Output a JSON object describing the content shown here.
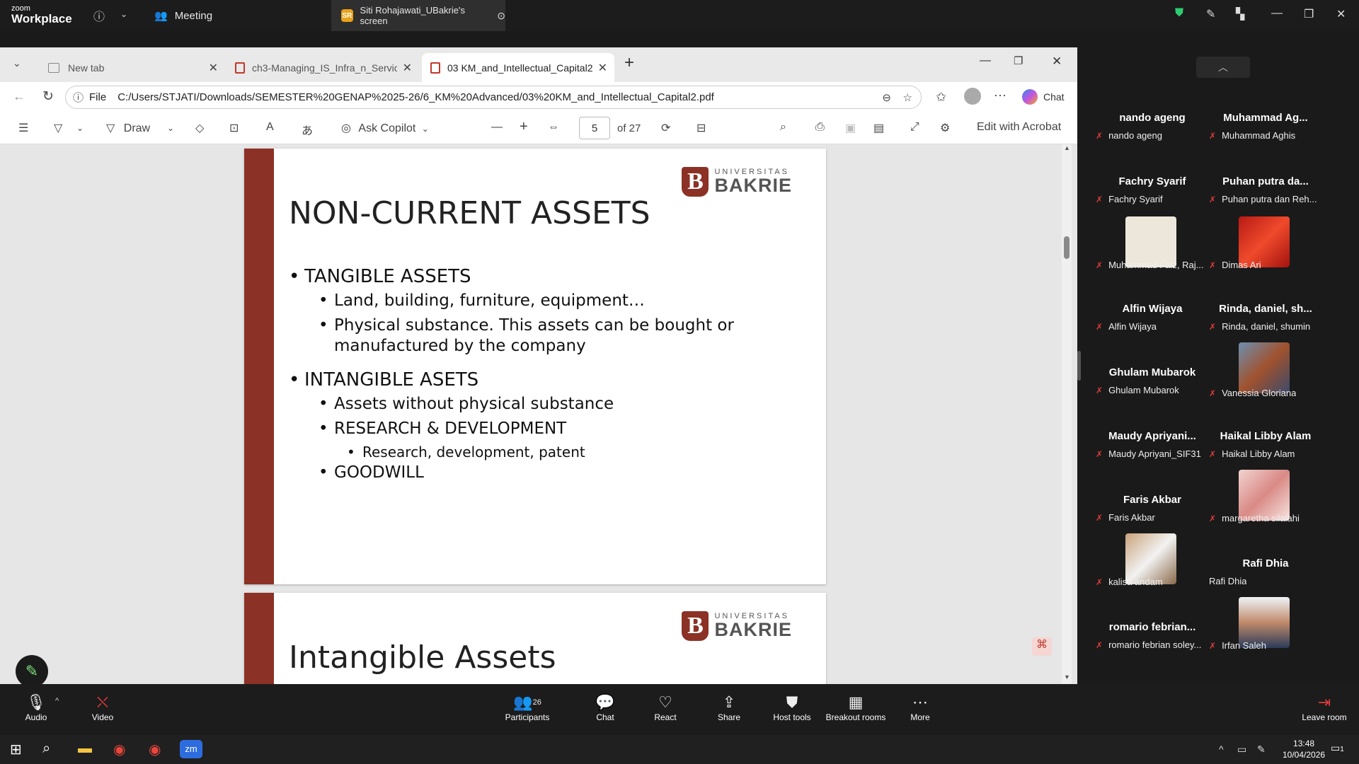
{
  "zoom": {
    "brand_top": "zoom",
    "brand": "Workplace",
    "meeting_tab": "Meeting",
    "share_badge": "SR",
    "share_tab": "Siti Rohajawati_UBakrie's screen"
  },
  "browser": {
    "tabs": [
      {
        "label": "New tab"
      },
      {
        "label": "ch3-Managing_IS_Infra_n_Services"
      },
      {
        "label": "03 KM_and_Intellectual_Capital2.pdf"
      }
    ],
    "url_prefix": "File",
    "url": "C:/Users/STJATI/Downloads/SEMESTER%20GENAP%2025-26/6_KM%20Advanced/03%20KM_and_Intellectual_Capital2.pdf",
    "chat_label": "Chat",
    "toolbar": {
      "draw": "Draw",
      "copilot": "Ask Copilot",
      "page": "5",
      "page_total": "of 27",
      "edit": "Edit with Acrobat"
    }
  },
  "slides": [
    {
      "logo_small": "UNIVERSITAS",
      "logo_big": "BAKRIE",
      "logo_letter": "B",
      "title": "NON-CURRENT ASSETS",
      "bullets": [
        "TANGIBLE ASSETS",
        "Land, building, furniture, equipment…",
        "Physical substance. This assets can be bought  or",
        "manufactured by the company",
        "INTANGIBLE ASETS",
        "Assets without physical substance",
        "RESEARCH & DEVELOPMENT",
        "Research, development, patent",
        "GOODWILL"
      ]
    },
    {
      "logo_small": "UNIVERSITAS",
      "logo_big": "BAKRIE",
      "logo_letter": "B",
      "title": "Intangible Assets"
    }
  ],
  "participants": [
    {
      "name": "nando ageng",
      "label": "nando ageng"
    },
    {
      "name": "Muhammad Ag...",
      "label": "Muhammad Aghis"
    },
    {
      "name": "Fachry Syarif",
      "label": "Fachry Syarif"
    },
    {
      "name": "Puhan putra da...",
      "label": "Puhan putra dan Reh..."
    },
    {
      "name": "",
      "label": "Muhammad Faiz, Raj..."
    },
    {
      "name": "",
      "label": "Dimas Ari"
    },
    {
      "name": "Alfin Wijaya",
      "label": "Alfin Wijaya"
    },
    {
      "name": "Rinda, daniel, sh...",
      "label": "Rinda, daniel, shumin"
    },
    {
      "name": "Ghulam Mubarok",
      "label": "Ghulam Mubarok"
    },
    {
      "name": "",
      "label": "Vanessia Gloriana"
    },
    {
      "name": "Maudy  Apriyani...",
      "label": "Maudy Apriyani_SIF31"
    },
    {
      "name": "Haikal Libby Alam",
      "label": "Haikal Libby Alam"
    },
    {
      "name": "Faris Akbar",
      "label": "Faris Akbar"
    },
    {
      "name": "",
      "label": "margaretha silalahi"
    },
    {
      "name": "",
      "label": "kalisa andam"
    },
    {
      "name": "Rafi Dhia",
      "label": "Rafi Dhia"
    },
    {
      "name": "romario  febrian...",
      "label": "romario febrian soley..."
    },
    {
      "name": "",
      "label": "Irfan Saleh"
    }
  ],
  "bottombar": {
    "audio": "Audio",
    "video": "Video",
    "participants": "Participants",
    "participants_count": "26",
    "chat": "Chat",
    "react": "React",
    "share": "Share",
    "host_tools": "Host tools",
    "breakout": "Breakout rooms",
    "more": "More",
    "leave": "Leave room"
  },
  "taskbar": {
    "time": "13:48",
    "date": "10/04/2026",
    "notif": "1"
  }
}
